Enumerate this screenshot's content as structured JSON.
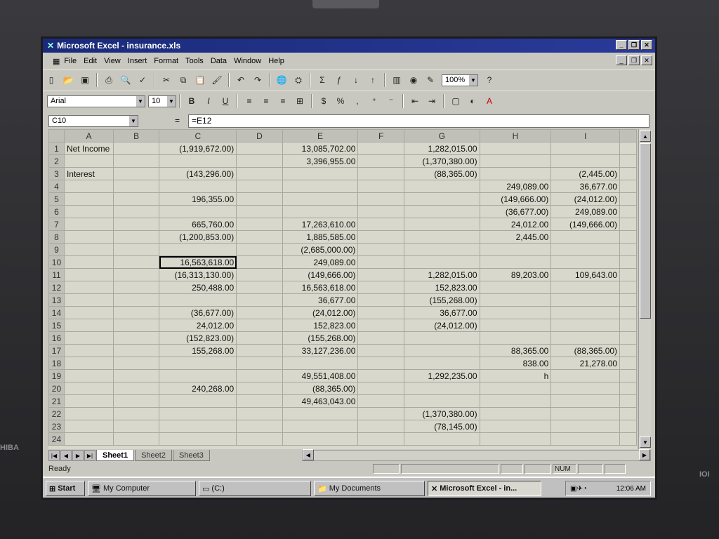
{
  "window": {
    "title": "Microsoft Excel - insurance.xls"
  },
  "menu": [
    "File",
    "Edit",
    "View",
    "Insert",
    "Format",
    "Tools",
    "Data",
    "Window",
    "Help"
  ],
  "toolbar": {
    "zoom": "100%",
    "font": "Arial",
    "font_size": "10"
  },
  "formula": {
    "cell_ref": "C10",
    "eq": "=",
    "content": "=E12"
  },
  "columns": [
    "A",
    "B",
    "C",
    "D",
    "E",
    "F",
    "G",
    "H",
    "I"
  ],
  "rows": [
    {
      "n": "1",
      "A": "Net Income",
      "B": "",
      "C": "(1,919,672.00)",
      "D": "",
      "E": "13,085,702.00",
      "F": "",
      "G": "1,282,015.00",
      "H": "",
      "I": ""
    },
    {
      "n": "2",
      "A": "",
      "B": "",
      "C": "",
      "D": "",
      "E": "3,396,955.00",
      "F": "",
      "G": "(1,370,380.00)",
      "H": "",
      "I": ""
    },
    {
      "n": "3",
      "A": "Interest",
      "B": "",
      "C": "(143,296.00)",
      "D": "",
      "E": "",
      "F": "",
      "G": "(88,365.00)",
      "H": "",
      "I": "(2,445.00)"
    },
    {
      "n": "4",
      "A": "",
      "B": "",
      "C": "",
      "D": "",
      "E": "",
      "F": "",
      "G": "",
      "H": "249,089.00",
      "I": "36,677.00"
    },
    {
      "n": "5",
      "A": "",
      "B": "",
      "C": "196,355.00",
      "D": "",
      "E": "",
      "F": "",
      "G": "",
      "H": "(149,666.00)",
      "I": "(24,012.00)"
    },
    {
      "n": "6",
      "A": "",
      "B": "",
      "C": "",
      "D": "",
      "E": "",
      "F": "",
      "G": "",
      "H": "(36,677.00)",
      "I": "249,089.00"
    },
    {
      "n": "7",
      "A": "",
      "B": "",
      "C": "665,760.00",
      "D": "",
      "E": "17,263,610.00",
      "F": "",
      "G": "",
      "H": "24,012.00",
      "I": "(149,666.00)"
    },
    {
      "n": "8",
      "A": "",
      "B": "",
      "C": "(1,200,853.00)",
      "D": "",
      "E": "1,885,585.00",
      "F": "",
      "G": "",
      "H": "2,445.00",
      "I": ""
    },
    {
      "n": "9",
      "A": "",
      "B": "",
      "C": "",
      "D": "",
      "E": "(2,685,000.00)",
      "F": "",
      "G": "",
      "H": "",
      "I": ""
    },
    {
      "n": "10",
      "A": "",
      "B": "",
      "C": "16,563,618.00",
      "D": "",
      "E": "249,089.00",
      "F": "",
      "G": "",
      "H": "",
      "I": ""
    },
    {
      "n": "11",
      "A": "",
      "B": "",
      "C": "(16,313,130.00)",
      "D": "",
      "E": "(149,666.00)",
      "F": "",
      "G": "1,282,015.00",
      "H": "89,203.00",
      "I": "109,643.00"
    },
    {
      "n": "12",
      "A": "",
      "B": "",
      "C": "250,488.00",
      "D": "",
      "E": "16,563,618.00",
      "F": "",
      "G": "152,823.00",
      "H": "",
      "I": ""
    },
    {
      "n": "13",
      "A": "",
      "B": "",
      "C": "",
      "D": "",
      "E": "36,677.00",
      "F": "",
      "G": "(155,268.00)",
      "H": "",
      "I": ""
    },
    {
      "n": "14",
      "A": "",
      "B": "",
      "C": "(36,677.00)",
      "D": "",
      "E": "(24,012.00)",
      "F": "",
      "G": "36,677.00",
      "H": "",
      "I": ""
    },
    {
      "n": "15",
      "A": "",
      "B": "",
      "C": "24,012.00",
      "D": "",
      "E": "152,823.00",
      "F": "",
      "G": "(24,012.00)",
      "H": "",
      "I": ""
    },
    {
      "n": "16",
      "A": "",
      "B": "",
      "C": "(152,823.00)",
      "D": "",
      "E": "(155,268.00)",
      "F": "",
      "G": "",
      "H": "",
      "I": ""
    },
    {
      "n": "17",
      "A": "",
      "B": "",
      "C": "155,268.00",
      "D": "",
      "E": "33,127,236.00",
      "F": "",
      "G": "",
      "H": "88,365.00",
      "I": "(88,365.00)"
    },
    {
      "n": "18",
      "A": "",
      "B": "",
      "C": "",
      "D": "",
      "E": "",
      "F": "",
      "G": "",
      "H": "838.00",
      "I": "21,278.00"
    },
    {
      "n": "19",
      "A": "",
      "B": "",
      "C": "",
      "D": "",
      "E": "49,551,408.00",
      "F": "",
      "G": "1,292,235.00",
      "H": "h",
      "I": ""
    },
    {
      "n": "20",
      "A": "",
      "B": "",
      "C": "240,268.00",
      "D": "",
      "E": "(88,365.00)",
      "F": "",
      "G": "",
      "H": "",
      "I": ""
    },
    {
      "n": "21",
      "A": "",
      "B": "",
      "C": "",
      "D": "",
      "E": "49,463,043.00",
      "F": "",
      "G": "",
      "H": "",
      "I": ""
    },
    {
      "n": "22",
      "A": "",
      "B": "",
      "C": "",
      "D": "",
      "E": "",
      "F": "",
      "G": "(1,370,380.00)",
      "H": "",
      "I": ""
    },
    {
      "n": "23",
      "A": "",
      "B": "",
      "C": "",
      "D": "",
      "E": "",
      "F": "",
      "G": "(78,145.00)",
      "H": "",
      "I": ""
    },
    {
      "n": "24",
      "A": "",
      "B": "",
      "C": "",
      "D": "",
      "E": "",
      "F": "",
      "G": "",
      "H": "",
      "I": ""
    }
  ],
  "selected_cell": {
    "row": "10",
    "col": "C"
  },
  "sheets": [
    "Sheet1",
    "Sheet2",
    "Sheet3"
  ],
  "status": {
    "ready": "Ready",
    "num": "NUM"
  },
  "taskbar": {
    "start": "Start",
    "items": [
      "My Computer",
      "(C:)",
      "My Documents",
      "Microsoft Excel - in..."
    ],
    "clock": "12:06 AM"
  },
  "side_labels": {
    "brand": "HIBA",
    "right": "IOI"
  }
}
